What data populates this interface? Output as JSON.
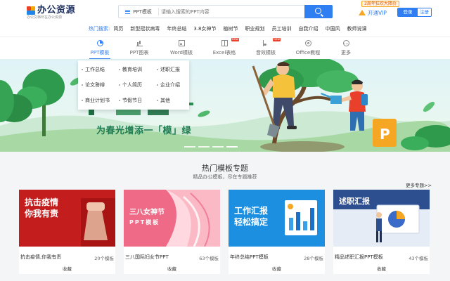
{
  "header": {
    "logo_title": "办公资源",
    "logo_sub": "办公文档尽在办公资源",
    "search_type": "PPT模板",
    "search_placeholder": "请输入搜索的PPT内容",
    "hot_label": "热门搜索:",
    "hot_keywords": [
      "简历",
      "新型冠状病毒",
      "年终总结",
      "3.8女神节",
      "植树节",
      "职业规划",
      "员工培训",
      "自我介绍",
      "中国风",
      "教师说课"
    ],
    "promo": "2周年狂欢大降价",
    "vip_label": "开通VIP",
    "login_label": "登录",
    "register_label": "注册"
  },
  "nav": {
    "items": [
      {
        "label": "PPT模板",
        "icon": "pie-chart-icon",
        "active": true,
        "new": false
      },
      {
        "label": "PPT图表",
        "icon": "bar-chart-icon",
        "active": false,
        "new": false
      },
      {
        "label": "Word模板",
        "icon": "document-icon",
        "active": false,
        "new": false
      },
      {
        "label": "Excel表格",
        "icon": "spreadsheet-icon",
        "active": false,
        "new": true
      },
      {
        "label": "音效模板",
        "icon": "music-note-icon",
        "active": false,
        "new": true
      },
      {
        "label": "Office教程",
        "icon": "office-icon",
        "active": false,
        "new": false
      },
      {
        "label": "更多",
        "icon": "more-icon",
        "active": false,
        "new": false
      }
    ],
    "new_badge": "new"
  },
  "dropdown": {
    "items": [
      "工作总结",
      "教育培训",
      "述职汇报",
      "论文答辩",
      "个人简历",
      "企业介绍",
      "商业计划书",
      "节假节日",
      "其他"
    ]
  },
  "banner": {
    "slogan": "为春光增添一「模」绿",
    "slide_count": 4,
    "active_slide": 3
  },
  "hot_section": {
    "title": "热门模板专题",
    "subtitle": "精品办公模板，尽在专题推荐",
    "more_label": "更多专题>>",
    "cards": [
      {
        "title": "抗击疫情,你我有责",
        "count": "20个模板",
        "fav": "收藏",
        "thumb_text": [
          "抗击疫情",
          "你我有责"
        ]
      },
      {
        "title": "三八国际妇女节PPT",
        "count": "63个模板",
        "fav": "收藏",
        "thumb_text": [
          "三八女神节",
          "PPT模板"
        ]
      },
      {
        "title": "年终总结PPT模板",
        "count": "28个模板",
        "fav": "收藏",
        "thumb_text": [
          "工作汇报",
          "轻松搞定"
        ]
      },
      {
        "title": "精品述职汇报PPT模板",
        "count": "43个模板",
        "fav": "收藏",
        "thumb_text": [
          "述职汇报"
        ]
      }
    ]
  },
  "colors": {
    "accent": "#2f7ef2",
    "logo_red": "#e8402a",
    "logo_orange": "#f7a600",
    "banner_green": "#1f7b52"
  }
}
